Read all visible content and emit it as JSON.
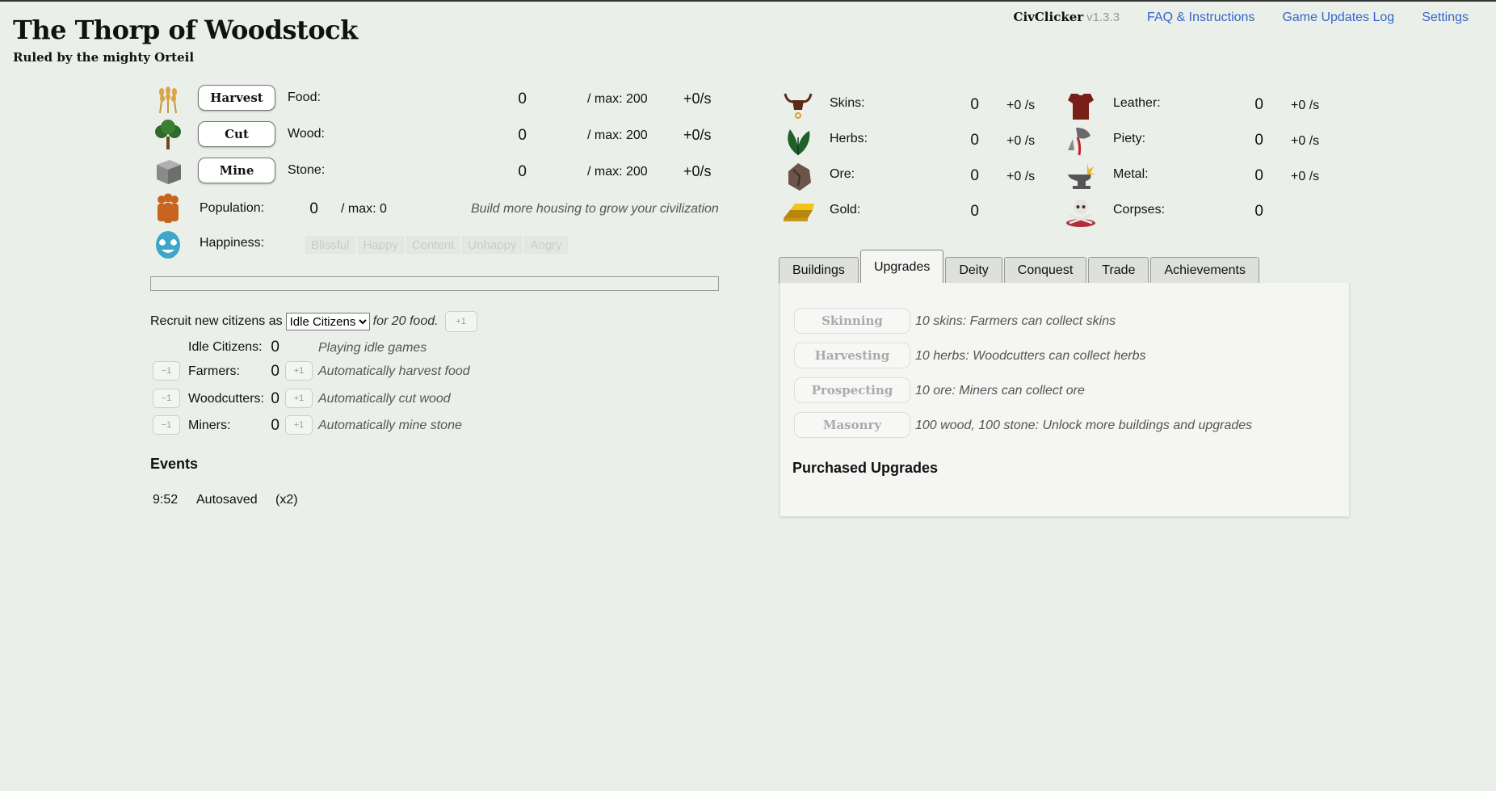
{
  "header": {
    "title": "The Thorp of Woodstock",
    "ruler": "Ruled by the mighty Orteil",
    "brand": "CivClicker",
    "version": "v1.3.3",
    "links": [
      "FAQ & Instructions",
      "Game Updates Log",
      "Settings"
    ]
  },
  "basic": [
    {
      "button": "Harvest",
      "label": "Food:",
      "value": "0",
      "max": "/ max: 200",
      "rate": "+0/s"
    },
    {
      "button": "Cut",
      "label": "Wood:",
      "value": "0",
      "max": "/ max: 200",
      "rate": "+0/s"
    },
    {
      "button": "Mine",
      "label": "Stone:",
      "value": "0",
      "max": "/ max: 200",
      "rate": "+0/s"
    }
  ],
  "population": {
    "label": "Population:",
    "value": "0",
    "max": "/ max: 0",
    "note": "Build more housing to grow your civilization"
  },
  "happiness": {
    "label": "Happiness:",
    "levels": [
      "Blissful",
      "Happy",
      "Content",
      "Unhappy",
      "Angry"
    ]
  },
  "recruit": {
    "prefix": "Recruit new citizens as",
    "selected": "Idle Citizens",
    "suffix": "for 20 food.",
    "plus": "+1"
  },
  "jobs": [
    {
      "label": "Idle Citizens:",
      "value": "0",
      "desc": "Playing idle games"
    },
    {
      "label": "Farmers:",
      "value": "0",
      "desc": "Automatically harvest food",
      "minus": "−1",
      "plus": "+1"
    },
    {
      "label": "Woodcutters:",
      "value": "0",
      "desc": "Automatically cut wood",
      "minus": "−1",
      "plus": "+1"
    },
    {
      "label": "Miners:",
      "value": "0",
      "desc": "Automatically mine stone",
      "minus": "−1",
      "plus": "+1"
    }
  ],
  "events": {
    "title": "Events",
    "items": [
      {
        "time": "9:52",
        "text": "Autosaved",
        "count": "(x2)"
      }
    ]
  },
  "special": [
    {
      "label": "Skins:",
      "value": "0",
      "rate": "+0 /s"
    },
    {
      "label": "Herbs:",
      "value": "0",
      "rate": "+0 /s"
    },
    {
      "label": "Ore:",
      "value": "0",
      "rate": "+0 /s"
    },
    {
      "label": "Gold:",
      "value": "0"
    },
    {
      "label": "Leather:",
      "value": "0",
      "rate": "+0 /s"
    },
    {
      "label": "Piety:",
      "value": "0",
      "rate": "+0 /s"
    },
    {
      "label": "Metal:",
      "value": "0",
      "rate": "+0 /s"
    },
    {
      "label": "Corpses:",
      "value": "0"
    }
  ],
  "tabs": [
    "Buildings",
    "Upgrades",
    "Deity",
    "Conquest",
    "Trade",
    "Achievements"
  ],
  "upgrades": [
    {
      "button": "Skinning",
      "cost": "10 skins:",
      "desc": "Farmers can collect skins"
    },
    {
      "button": "Harvesting",
      "cost": "10 herbs:",
      "desc": "Woodcutters can collect herbs"
    },
    {
      "button": "Prospecting",
      "cost": "10 ore:",
      "desc": "Miners can collect ore"
    },
    {
      "button": "Masonry",
      "cost": "100 wood, 100 stone:",
      "desc": "Unlock more buildings and upgrades"
    }
  ],
  "purchased_title": "Purchased Upgrades"
}
